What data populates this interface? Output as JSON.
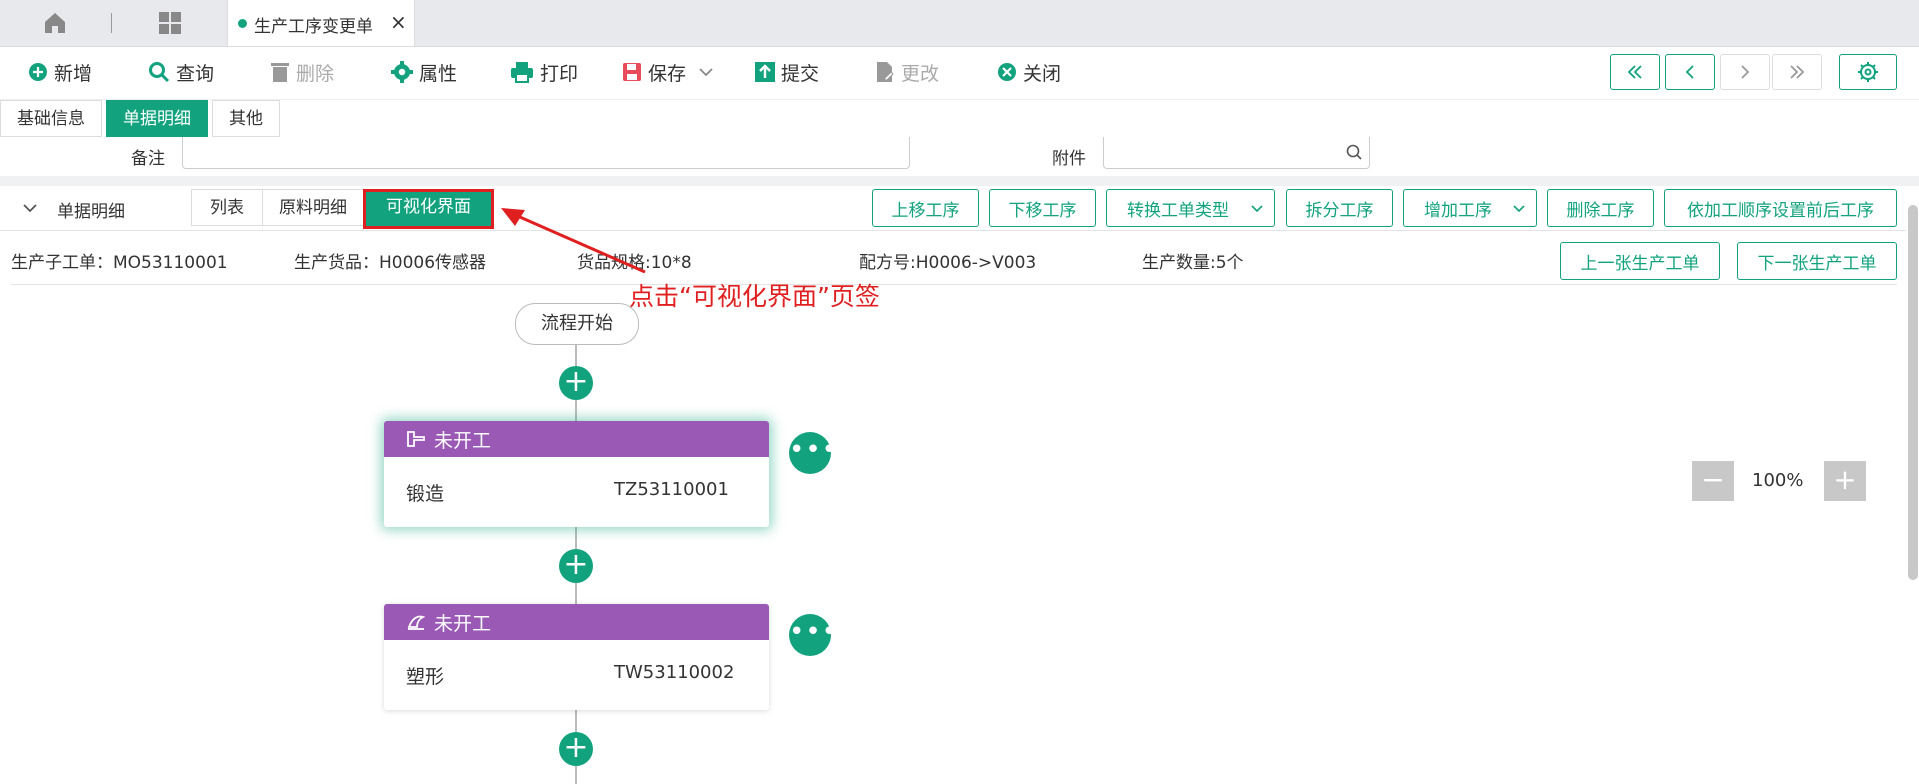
{
  "tabbar": {
    "doc_tab_label": "生产工序变更单"
  },
  "toolbar": {
    "new": "新增",
    "query": "查询",
    "delete": "删除",
    "properties": "属性",
    "print": "打印",
    "save": "保存",
    "submit": "提交",
    "modify": "更改",
    "close": "关闭"
  },
  "section_tabs": {
    "basic": "基础信息",
    "detail": "单据明细",
    "other": "其他"
  },
  "fields": {
    "remark_label": "备注",
    "remark_value": "",
    "attachment_label": "附件",
    "attachment_value": ""
  },
  "detail": {
    "title": "单据明细",
    "view_tabs": {
      "list": "列表",
      "materials": "原料明细",
      "visual": "可视化界面"
    },
    "actions": {
      "move_up": "上移工序",
      "move_down": "下移工序",
      "convert_type": "转换工单类型",
      "split": "拆分工序",
      "add": "增加工序",
      "delete": "删除工序",
      "set_order": "依加工顺序设置前后工序"
    },
    "info": {
      "sub_order": "生产子工单：MO53110001",
      "goods": "生产货品：H0006传感器",
      "spec": "货品规格:10*8",
      "formula": "配方号:H0006->V003",
      "quantity": "生产数量:5个"
    },
    "prev_order": "上一张生产工单",
    "next_order": "下一张生产工单"
  },
  "annotation": "点击“可视化界面”页签",
  "flow": {
    "start_label": "流程开始",
    "cards": [
      {
        "status": "未开工",
        "name": "锻造",
        "code": "TZ53110001"
      },
      {
        "status": "未开工",
        "name": "塑形",
        "code": "TW53110002"
      }
    ]
  },
  "zoom": {
    "level": "100%"
  },
  "colors": {
    "accent": "#12a37e",
    "card_header": "#9b59b6",
    "annotation": "#e02020"
  }
}
